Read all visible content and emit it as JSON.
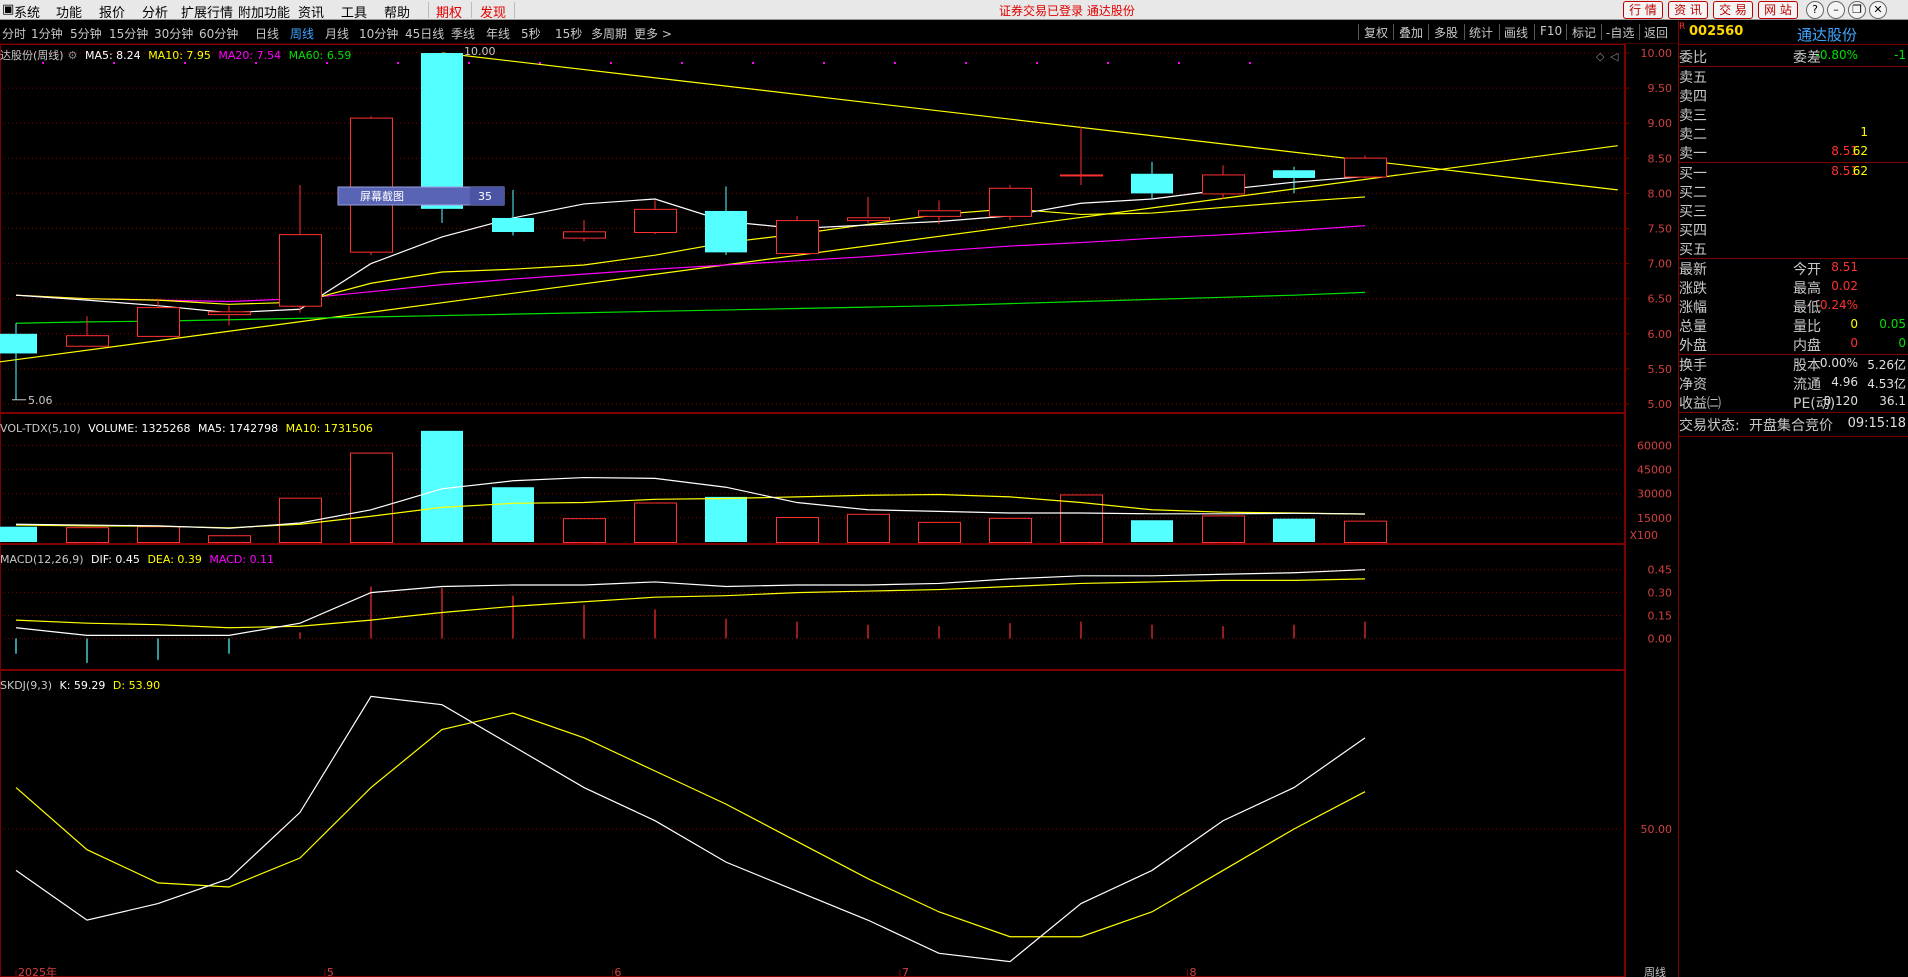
{
  "menu": {
    "items": [
      "系统",
      "功能",
      "报价",
      "分析",
      "扩展行情",
      "附加功能",
      "资讯",
      "工具",
      "帮助"
    ],
    "red_items": [
      "期权",
      "发现"
    ],
    "status": "证券交易已登录  通达股份",
    "right_buttons": [
      "行 情",
      "资 讯",
      "交 易",
      "网 站"
    ]
  },
  "periods": {
    "items": [
      "分时",
      "1分钟",
      "5分钟",
      "15分钟",
      "30分钟",
      "60分钟",
      "日线",
      "周线",
      "月线",
      "10分钟",
      "45日线",
      "季线",
      "年线",
      "5秒",
      "15秒",
      "多周期",
      "更多 >"
    ],
    "active": "周线",
    "right_items": [
      "复权",
      "叠加",
      "多股",
      "统计",
      "画线",
      "F10",
      "标记",
      "-自选",
      "返回"
    ]
  },
  "main_legend": {
    "title": "达股份(周线)",
    "ma5": "MA5: 8.24",
    "ma10": "MA10: 7.95",
    "ma20": "MA20: 7.54",
    "ma60": "MA60: 6.59"
  },
  "main_axis": [
    "10.00",
    "9.50",
    "9.00",
    "8.50",
    "8.00",
    "7.50",
    "7.00",
    "6.50",
    "6.00",
    "5.50",
    "5.00"
  ],
  "annotations": {
    "high_label": "10.00",
    "low_label": "5.06",
    "tooltip_label": "屏幕截图",
    "tooltip_value": "35"
  },
  "vol_legend": {
    "title": "VOL-TDX(5,10)",
    "volume": "VOLUME: 1325268",
    "ma5": "MA5: 1742798",
    "ma10": "MA10: 1731506"
  },
  "vol_axis": [
    "60000",
    "45000",
    "30000",
    "15000"
  ],
  "vol_unit": "X100",
  "macd_legend": {
    "title": "MACD(12,26,9)",
    "dif": "DIF: 0.45",
    "dea": "DEA: 0.39",
    "macd": "MACD: 0.11"
  },
  "macd_axis": [
    "0.45",
    "0.30",
    "0.15",
    "0.00"
  ],
  "skdj_legend": {
    "title": "SKDJ(9,3)",
    "k": "K: 59.29",
    "d": "D: 53.90"
  },
  "skdj_axis": [
    "50.00"
  ],
  "x_labels": [
    "2025年",
    "5",
    "6",
    "7",
    "8"
  ],
  "period_label": "周线",
  "chart_data": {
    "type": "candlestick",
    "candles": [
      {
        "o": 6.0,
        "h": 6.15,
        "l": 5.06,
        "c": 5.72
      },
      {
        "o": 5.83,
        "h": 6.25,
        "l": 5.82,
        "c": 5.98
      },
      {
        "o": 5.97,
        "h": 6.5,
        "l": 5.95,
        "c": 6.38
      },
      {
        "o": 6.28,
        "h": 6.4,
        "l": 6.12,
        "c": 6.32
      },
      {
        "o": 6.4,
        "h": 8.12,
        "l": 6.3,
        "c": 7.42
      },
      {
        "o": 7.17,
        "h": 9.1,
        "l": 7.12,
        "c": 9.08
      },
      {
        "o": 10.0,
        "h": 10.0,
        "l": 7.58,
        "c": 7.78
      },
      {
        "o": 7.65,
        "h": 8.05,
        "l": 7.4,
        "c": 7.45
      },
      {
        "o": 7.37,
        "h": 7.62,
        "l": 7.32,
        "c": 7.46
      },
      {
        "o": 7.45,
        "h": 7.9,
        "l": 7.42,
        "c": 7.78
      },
      {
        "o": 7.75,
        "h": 8.1,
        "l": 7.12,
        "c": 7.16
      },
      {
        "o": 7.15,
        "h": 7.68,
        "l": 7.14,
        "c": 7.62
      },
      {
        "o": 7.62,
        "h": 7.95,
        "l": 7.58,
        "c": 7.66
      },
      {
        "o": 7.68,
        "h": 7.9,
        "l": 7.56,
        "c": 7.76
      },
      {
        "o": 7.68,
        "h": 8.12,
        "l": 7.62,
        "c": 8.08
      },
      {
        "o": 8.27,
        "h": 8.95,
        "l": 8.12,
        "c": 8.27
      },
      {
        "o": 8.28,
        "h": 8.45,
        "l": 7.92,
        "c": 8.0
      },
      {
        "o": 8.0,
        "h": 8.4,
        "l": 7.92,
        "c": 8.27
      },
      {
        "o": 8.33,
        "h": 8.38,
        "l": 8.0,
        "c": 8.22
      },
      {
        "o": 8.24,
        "h": 8.54,
        "l": 8.22,
        "c": 8.51
      }
    ],
    "ma5": [
      6.55,
      6.48,
      6.4,
      6.3,
      6.35,
      7.0,
      7.38,
      7.65,
      7.85,
      7.92,
      7.6,
      7.5,
      7.55,
      7.6,
      7.68,
      7.86,
      7.92,
      8.05,
      8.16,
      8.24
    ],
    "ma10": [
      6.55,
      6.5,
      6.48,
      6.42,
      6.45,
      6.72,
      6.88,
      6.92,
      6.98,
      7.12,
      7.3,
      7.42,
      7.56,
      7.7,
      7.78,
      7.7,
      7.72,
      7.8,
      7.88,
      7.95
    ],
    "ma20": [
      6.55,
      6.5,
      6.48,
      6.46,
      6.5,
      6.6,
      6.7,
      6.78,
      6.85,
      6.92,
      6.98,
      7.04,
      7.1,
      7.18,
      7.25,
      7.3,
      7.36,
      7.41,
      7.47,
      7.54
    ],
    "ma60": [
      6.15,
      6.17,
      6.18,
      6.2,
      6.22,
      6.24,
      6.26,
      6.28,
      6.3,
      6.32,
      6.34,
      6.36,
      6.38,
      6.4,
      6.43,
      6.46,
      6.49,
      6.52,
      6.55,
      6.59
    ],
    "volume": [
      9500,
      9200,
      9800,
      4200,
      27500,
      55500,
      69000,
      34000,
      14800,
      24500,
      28000,
      15500,
      17500,
      12500,
      15000,
      29500,
      13500,
      16500,
      14500,
      13252
    ],
    "vol_ma5": [
      11000,
      10500,
      10000,
      8500,
      11800,
      20000,
      33000,
      38000,
      40000,
      39500,
      34000,
      24500,
      20000,
      19000,
      18000,
      18000,
      17500,
      17500,
      17800,
      17428
    ],
    "vol_ma10": [
      10500,
      10000,
      9800,
      8800,
      11000,
      16000,
      21500,
      24000,
      24500,
      26500,
      27000,
      28000,
      29000,
      29500,
      28000,
      24500,
      20000,
      18500,
      18000,
      17315
    ],
    "dif": [
      0.07,
      0.02,
      0.02,
      0.02,
      0.1,
      0.3,
      0.34,
      0.35,
      0.35,
      0.37,
      0.34,
      0.35,
      0.35,
      0.36,
      0.39,
      0.41,
      0.41,
      0.42,
      0.43,
      0.45
    ],
    "dea": [
      0.12,
      0.1,
      0.09,
      0.07,
      0.08,
      0.12,
      0.17,
      0.21,
      0.24,
      0.27,
      0.28,
      0.3,
      0.31,
      0.32,
      0.34,
      0.36,
      0.37,
      0.38,
      0.38,
      0.39
    ],
    "macd": [
      -0.1,
      -0.16,
      -0.14,
      -0.1,
      0.04,
      0.34,
      0.33,
      0.28,
      0.22,
      0.19,
      0.13,
      0.11,
      0.09,
      0.08,
      0.1,
      0.11,
      0.09,
      0.08,
      0.09,
      0.11
    ],
    "k": [
      40,
      28,
      32,
      38,
      54,
      82,
      80,
      70,
      60,
      52,
      42,
      35,
      28,
      20,
      18,
      32,
      40,
      52,
      60,
      72
    ],
    "d": [
      60,
      45,
      37,
      36,
      43,
      60,
      74,
      78,
      72,
      64,
      56,
      47,
      38,
      30,
      24,
      24,
      30,
      40,
      50,
      59
    ],
    "price_range": [
      4.9,
      10.1
    ],
    "volume_range": [
      0,
      72000
    ],
    "macd_range": [
      -0.2,
      0.52
    ],
    "kd_range": [
      15,
      85
    ],
    "colors": {
      "up": "#ff3030",
      "down": "#54ffff",
      "ma5": "#ffffff",
      "ma10": "#ffff00",
      "ma20": "#ff00ff",
      "ma60": "#00e000",
      "grid": "#800000",
      "trend": "#ffff00"
    }
  },
  "quote": {
    "code": "002560",
    "name": "通达股份",
    "weibi_label": "委比",
    "weibi": "-0.80%",
    "weicha_label": "委差",
    "weicha": "-1",
    "sell": [
      {
        "label": "卖五",
        "price": "",
        "vol": ""
      },
      {
        "label": "卖四",
        "price": "",
        "vol": ""
      },
      {
        "label": "卖三",
        "price": "",
        "vol": ""
      },
      {
        "label": "卖二",
        "price": "",
        "vol": "1"
      },
      {
        "label": "卖一",
        "price": "8.51",
        "vol": "62"
      }
    ],
    "buy": [
      {
        "label": "买一",
        "price": "8.51",
        "vol": "62"
      },
      {
        "label": "买二",
        "price": "",
        "vol": ""
      },
      {
        "label": "买三",
        "price": "",
        "vol": ""
      },
      {
        "label": "买四",
        "price": "",
        "vol": ""
      },
      {
        "label": "买五",
        "price": "",
        "vol": ""
      }
    ],
    "stats": [
      {
        "l1": "最新",
        "v1": "8.51",
        "c1": "red",
        "l2": "今开",
        "v2": "",
        "c2": "white"
      },
      {
        "l1": "涨跌",
        "v1": "0.02",
        "c1": "red",
        "l2": "最高",
        "v2": "",
        "c2": "white"
      },
      {
        "l1": "涨幅",
        "v1": "0.24%",
        "c1": "red",
        "l2": "最低",
        "v2": "",
        "c2": "white"
      },
      {
        "l1": "总量",
        "v1": "0",
        "c1": "yellow",
        "l2": "量比",
        "v2": "0.05",
        "c2": "green"
      },
      {
        "l1": "外盘",
        "v1": "0",
        "c1": "red",
        "l2": "内盘",
        "v2": "0",
        "c2": "green"
      }
    ],
    "stats2": [
      {
        "l1": "换手",
        "v1": "0.00%",
        "l2": "股本",
        "v2": "5.26亿"
      },
      {
        "l1": "净资",
        "v1": "4.96",
        "l2": "流通",
        "v2": "4.53亿"
      },
      {
        "l1": "收益㈡",
        "v1": "0.120",
        "l2": "PE(动)",
        "v2": "36.1"
      }
    ],
    "trade_state_label": "交易状态:",
    "trade_state": "开盘集合竞价",
    "time": "09:15:18"
  }
}
